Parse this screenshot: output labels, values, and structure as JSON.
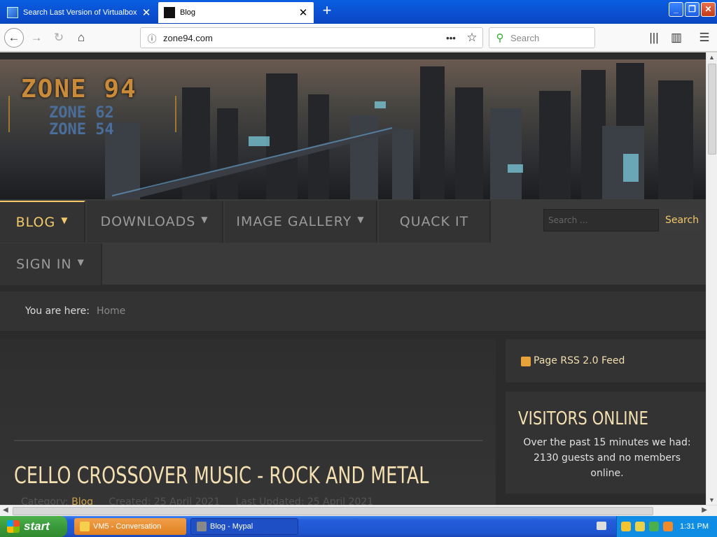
{
  "browser": {
    "tabs": [
      {
        "title": "Search Last Version of Virtualbox",
        "active": false
      },
      {
        "title": "Blog",
        "active": true
      }
    ],
    "url": "zone94.com",
    "search_placeholder": "Search",
    "icons": {
      "back": "back-arrow-icon",
      "forward": "forward-arrow-icon",
      "reload": "reload-icon",
      "home": "home-icon",
      "info": "info-icon",
      "page_actions": "more-dots-icon",
      "bookmark": "star-icon",
      "library": "library-icon",
      "sidebar": "sidebar-icon",
      "menu": "hamburger-menu-icon"
    }
  },
  "site": {
    "logo": {
      "line1": "ZONE 94",
      "line2": "ZONE 62",
      "line3": "ZONE 54"
    },
    "nav": [
      {
        "label": "BLOG",
        "has_dropdown": true,
        "active": true
      },
      {
        "label": "DOWNLOADS",
        "has_dropdown": true
      },
      {
        "label": "IMAGE GALLERY",
        "has_dropdown": true
      },
      {
        "label": "QUACK IT",
        "has_dropdown": false
      },
      {
        "label": "SIGN IN",
        "has_dropdown": true
      }
    ],
    "search": {
      "placeholder": "Search ...",
      "button": "Search"
    },
    "breadcrumb": {
      "prefix": "You are here:",
      "current": "Home"
    },
    "article": {
      "title": "CELLO CROSSOVER MUSIC - ROCK AND METAL",
      "category_label": "Category:",
      "category": "Blog",
      "created": "Created: 25 April 2021",
      "updated": "Last Updated: 25 April 2021"
    },
    "sidebar": {
      "rss": "Page RSS 2.0 Feed",
      "visitors_title": "VISITORS ONLINE",
      "visitors_text": "Over the past 15 minutes we had: 2130 guests and no members online."
    },
    "colors": {
      "accent": "#f3c96a",
      "title": "#f3dfb0",
      "bg": "#2b2b2b"
    }
  },
  "taskbar": {
    "start": "start",
    "buttons": [
      {
        "label": "VM5 - Conversation"
      },
      {
        "label": "Blog - Mypal"
      }
    ],
    "clock": "1:31 PM"
  }
}
